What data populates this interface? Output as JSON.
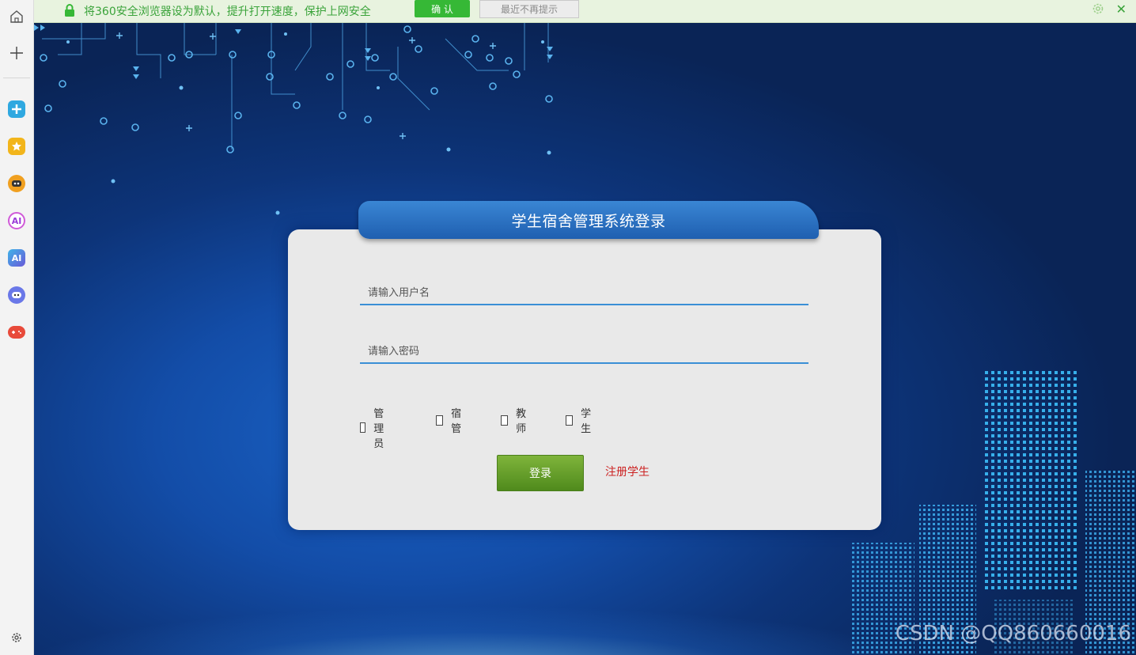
{
  "notification": {
    "message": "将360安全浏览器设为默认，提升打开速度，保护上网安全",
    "confirm_label": "确 认",
    "dismiss_label": "最近不再提示"
  },
  "sidebar": {
    "apps": [
      {
        "name": "tool-icon",
        "color": "#2fa8e0"
      },
      {
        "name": "favorites-star-icon",
        "color": "#f2b51b"
      },
      {
        "name": "chat-bot-icon",
        "color": "#f0a020"
      },
      {
        "name": "ai-assistant-icon",
        "label": "AI",
        "color": "#d05ad8"
      },
      {
        "name": "ai-app-icon",
        "label": "AI",
        "color": "#3b7de0"
      },
      {
        "name": "robot-icon",
        "color": "#6a78e8"
      },
      {
        "name": "game-controller-icon",
        "color": "#e84a3a"
      }
    ]
  },
  "login": {
    "title": "学生宿舍管理系统登录",
    "username_placeholder": "请输入用户名",
    "password_placeholder": "请输入密码",
    "roles": [
      "管理员",
      "宿管",
      "教师",
      "学生"
    ],
    "login_label": "登录",
    "register_label": "注册学生"
  },
  "watermark": "CSDN @QQ860660016",
  "colors": {
    "accent_blue": "#1f5fb0",
    "login_green": "#5f9a25",
    "register_red": "#cc2222",
    "notify_green": "#3aa33a"
  }
}
